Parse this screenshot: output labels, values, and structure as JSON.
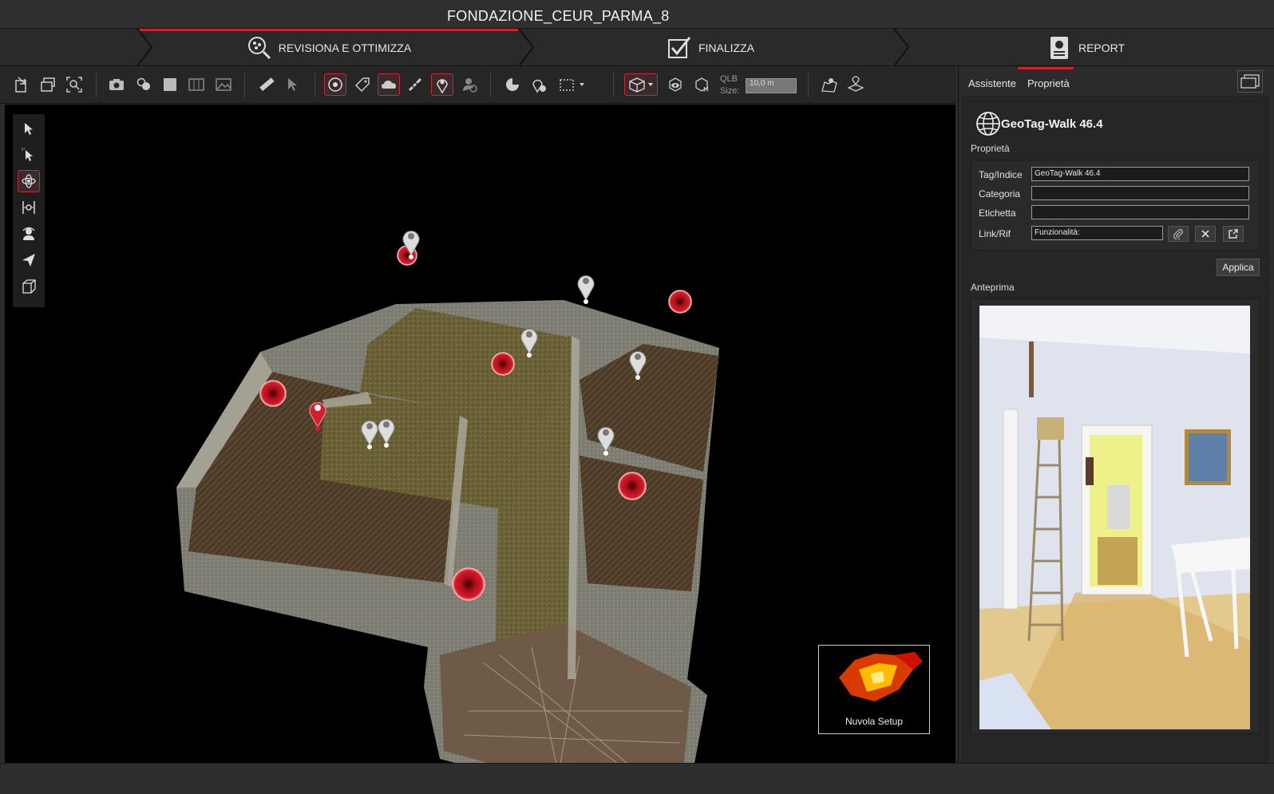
{
  "window": {
    "title": "FONDAZIONE_CEUR_PARMA_8"
  },
  "steps": [
    {
      "label": "REVISIONA E OTTIMIZZA",
      "icon": "review-optimize-icon",
      "active": true
    },
    {
      "label": "FINALIZZA",
      "icon": "checkbox-icon",
      "active": false
    },
    {
      "label": "REPORT",
      "icon": "report-icon",
      "active": false
    }
  ],
  "toolbar": {
    "qlb_label_1": "QLB",
    "qlb_label_2": "Size:",
    "qlb_value": "10,0 m"
  },
  "right_panel": {
    "tabs": [
      {
        "label": "Assistente",
        "active": false
      },
      {
        "label": "Proprietà",
        "active": true
      }
    ],
    "object_title": "GeoTag-Walk 46.4",
    "section_properties": "Proprietà",
    "fields": {
      "tag_label": "Tag/Indice",
      "tag_value": "GeoTag-Walk 46.4",
      "category_label": "Categoria",
      "category_value": "",
      "label_label": "Etichetta",
      "label_value": "",
      "link_label": "Link/Rif",
      "link_value": "Funzionalità:"
    },
    "apply_label": "Applica",
    "section_preview": "Anteprima"
  },
  "minimap": {
    "label": "Nuvola Setup"
  },
  "colors": {
    "accent": "#d11f2e",
    "panel_bg": "#2b2b2b",
    "viewport_bg": "#000000"
  }
}
